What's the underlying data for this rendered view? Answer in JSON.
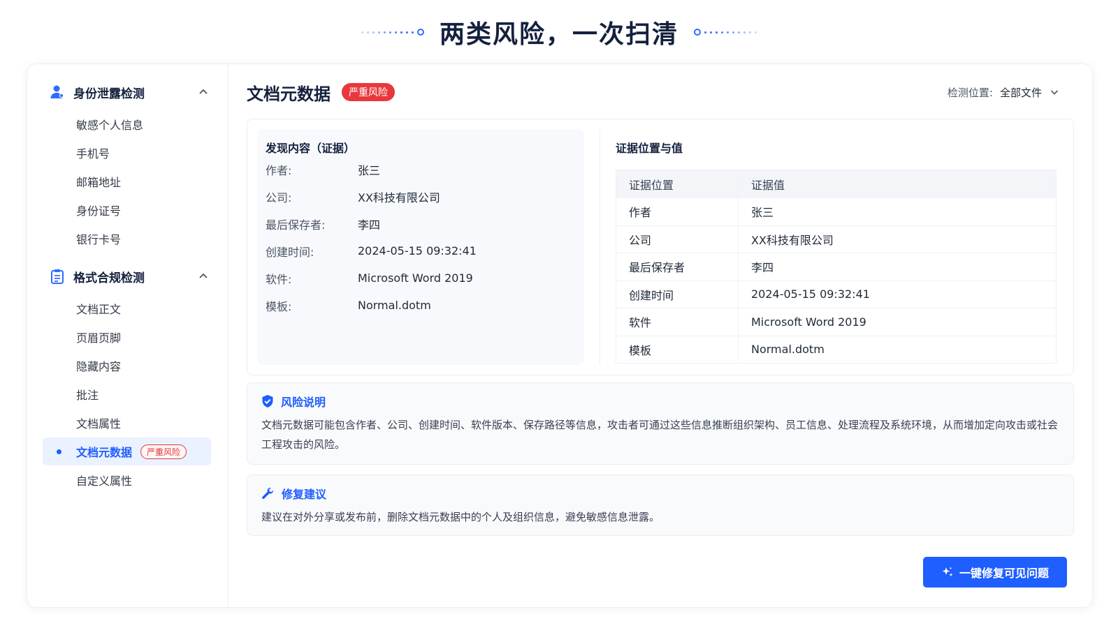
{
  "hero": {
    "title": "两类风险，一次扫清"
  },
  "sidebar": {
    "groups": [
      {
        "title": "身份泄露检测",
        "icon": "user-icon",
        "items": [
          {
            "label": "敏感个人信息"
          },
          {
            "label": "手机号"
          },
          {
            "label": "邮箱地址"
          },
          {
            "label": "身份证号"
          },
          {
            "label": "银行卡号"
          }
        ]
      },
      {
        "title": "格式合规检测",
        "icon": "clipboard-icon",
        "items": [
          {
            "label": "文档正文"
          },
          {
            "label": "页眉页脚"
          },
          {
            "label": "隐藏内容"
          },
          {
            "label": "批注"
          },
          {
            "label": "文档属性"
          },
          {
            "label": "文档元数据",
            "badge": "严重风险",
            "active": true
          },
          {
            "label": "自定义属性"
          }
        ]
      }
    ]
  },
  "main": {
    "title": "文档元数据",
    "badge": "严重风险",
    "location_label": "检测位置:",
    "location_value": "全部文件",
    "found": {
      "title": "发现内容（证据）",
      "rows": [
        {
          "k": "作者:",
          "v": "张三"
        },
        {
          "k": "公司:",
          "v": "XX科技有限公司"
        },
        {
          "k": "最后保存者:",
          "v": "李四"
        },
        {
          "k": "创建时间:",
          "v": "2024-05-15 09:32:41"
        },
        {
          "k": "软件:",
          "v": "Microsoft Word 2019"
        },
        {
          "k": "模板:",
          "v": "Normal.dotm"
        }
      ]
    },
    "evidence": {
      "title": "证据位置与值",
      "headers": [
        "证据位置",
        "证据值"
      ],
      "rows": [
        [
          "作者",
          "张三"
        ],
        [
          "公司",
          "XX科技有限公司"
        ],
        [
          "最后保存者",
          "李四"
        ],
        [
          "创建时间",
          "2024-05-15 09:32:41"
        ],
        [
          "软件",
          "Microsoft Word 2019"
        ],
        [
          "模板",
          "Normal.dotm"
        ]
      ]
    },
    "risk": {
      "title": "风险说明",
      "text": "文档元数据可能包含作者、公司、创建时间、软件版本、保存路径等信息，攻击者可通过这些信息推断组织架构、员工信息、处理流程及系统环境，从而增加定向攻击或社会工程攻击的风险。"
    },
    "fix": {
      "title": "修复建议",
      "text": "建议在对外分享或发布前，删除文档元数据中的个人及组织信息，避免敏感信息泄露。"
    },
    "fix_button": "一键修复可见问题"
  },
  "colors": {
    "accent": "#1f5eff",
    "danger": "#e8383d",
    "title": "#14213d"
  }
}
